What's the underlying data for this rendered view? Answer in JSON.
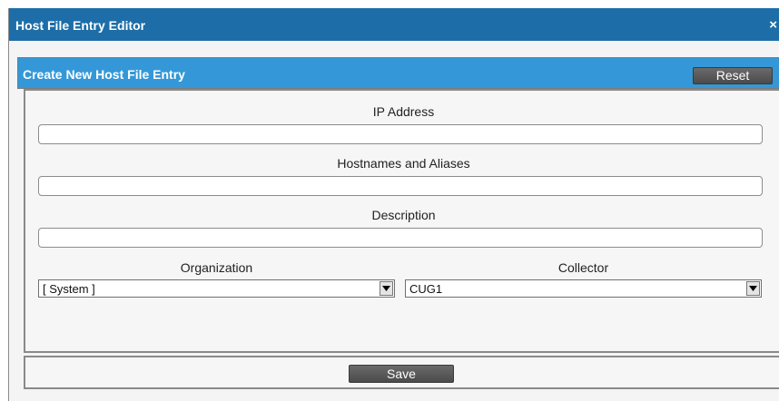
{
  "dialog": {
    "title": "Host File Entry Editor",
    "close_icon": "close-icon",
    "close_glyph": "×"
  },
  "panel": {
    "title": "Create New Host File Entry",
    "reset_label": "Reset"
  },
  "form": {
    "ip_address": {
      "label": "IP Address",
      "value": ""
    },
    "hostnames": {
      "label": "Hostnames and Aliases",
      "value": ""
    },
    "description": {
      "label": "Description",
      "value": ""
    },
    "organization": {
      "label": "Organization",
      "selected": "[ System ]"
    },
    "collector": {
      "label": "Collector",
      "selected": "CUG1"
    }
  },
  "footer": {
    "save_label": "Save"
  },
  "colors": {
    "titlebar": "#1d6ea8",
    "panel_header": "#3498d8",
    "button": "#555555"
  }
}
